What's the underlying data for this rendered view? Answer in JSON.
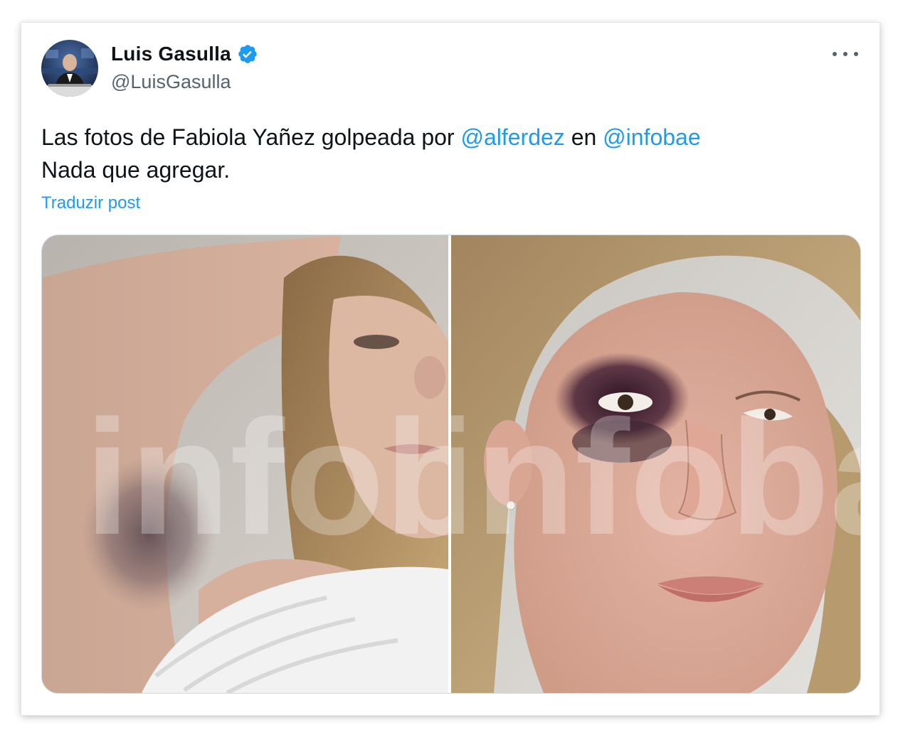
{
  "tweet": {
    "author": {
      "display_name": "Luis Gasulla",
      "handle": "@LuisGasulla",
      "verified": true
    },
    "text_parts": {
      "prefix": "Las fotos de Fabiola Yañez golpeada por ",
      "mention1": "@alferdez",
      "middle": " en ",
      "mention2": "@infobae",
      "line2": "Nada que agregar."
    },
    "translate_label": "Traduzir post",
    "more_icon": "more-horizontal-icon",
    "watermark": "infobae"
  },
  "colors": {
    "link": "#1d9bf0",
    "text": "#0f1419",
    "secondary": "#536471",
    "verified_badge": "#1d9bf0"
  }
}
